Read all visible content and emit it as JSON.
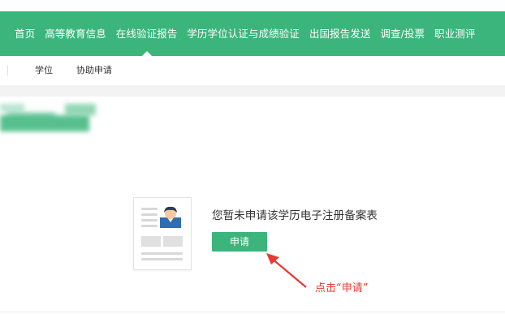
{
  "nav": {
    "items": [
      {
        "label": "首页"
      },
      {
        "label": "高等教育信息"
      },
      {
        "label": "在线验证报告"
      },
      {
        "label": "学历学位认证与成绩验证"
      },
      {
        "label": "出国报告发送"
      },
      {
        "label": "调查/投票"
      },
      {
        "label": "职业测评"
      }
    ],
    "active_index": 2
  },
  "subnav": {
    "items": [
      {
        "label": "学位"
      },
      {
        "label": "协助申请"
      }
    ]
  },
  "empty_state": {
    "message": "您暂未申请该学历电子注册备案表",
    "apply_label": "申请"
  },
  "annotation": {
    "hint": "点击“申请”"
  },
  "colors": {
    "primary": "#3bb57c",
    "annotation": "#e83a32"
  }
}
